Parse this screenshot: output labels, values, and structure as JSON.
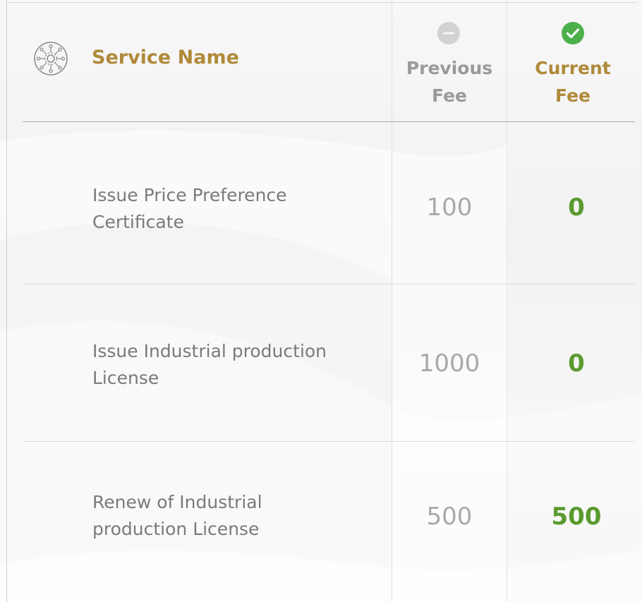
{
  "header": {
    "service_name": "Service Name",
    "previous_fee_line1": "Previous",
    "previous_fee_line2": "Fee",
    "current_fee_line1": "Current",
    "current_fee_line2": "Fee"
  },
  "icons": {
    "service": "gear-network-icon",
    "previous": "minus-circle-icon",
    "current": "check-circle-icon"
  },
  "colors": {
    "gold": "#b08a3a",
    "green": "#5a9a2f",
    "gray_text": "#7a7a7a",
    "light_gray": "#a8a8a8",
    "check_green": "#4cb04a",
    "minus_gray": "#d2d2d2"
  },
  "rows": [
    {
      "service_line1": "Issue Price Preference",
      "service_line2": "Certificate",
      "previous_fee": "100",
      "current_fee": "0"
    },
    {
      "service_line1": "Issue Industrial production",
      "service_line2": "License",
      "previous_fee": "1000",
      "current_fee": "0"
    },
    {
      "service_line1": "Renew of Industrial",
      "service_line2": "production License",
      "previous_fee": "500",
      "current_fee": "500"
    }
  ]
}
